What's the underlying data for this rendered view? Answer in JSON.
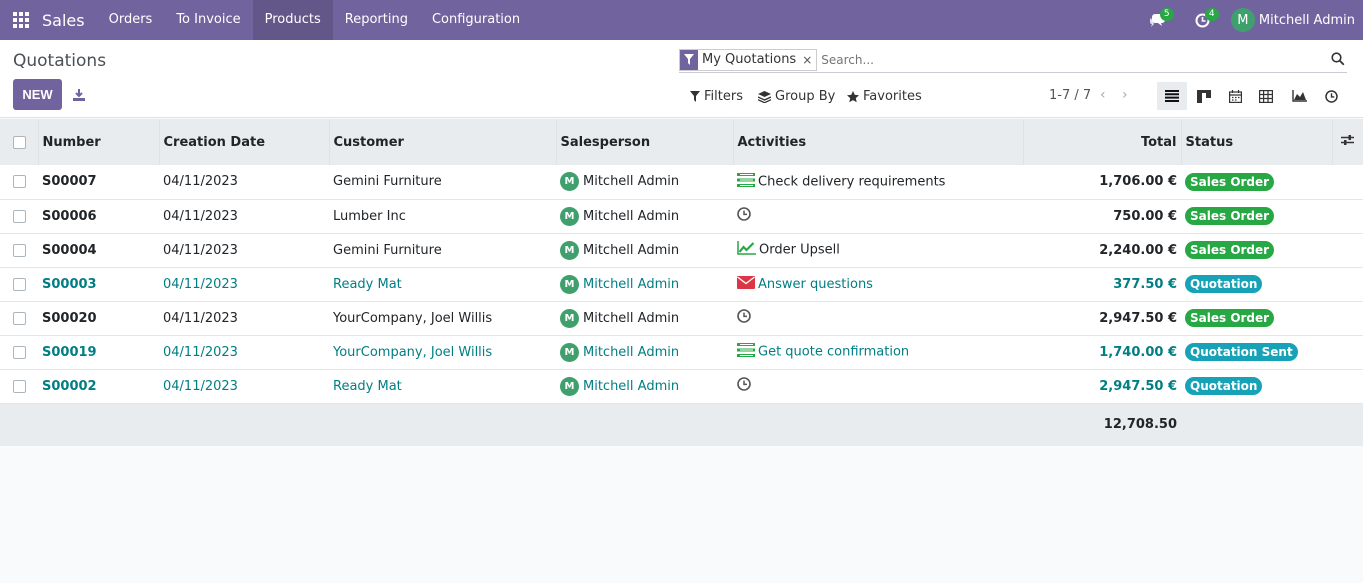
{
  "app": {
    "name": "Sales"
  },
  "nav": [
    "Orders",
    "To Invoice",
    "Products",
    "Reporting",
    "Configuration"
  ],
  "systray": {
    "messages_count": "5",
    "activities_count": "4",
    "user": "Mitchell Admin",
    "user_initial": "M"
  },
  "control": {
    "title": "Quotations",
    "new_label": "NEW",
    "facet": "My Quotations",
    "facet_remove": "×",
    "search_placeholder": "Search...",
    "filters": "Filters",
    "group_by": "Group By",
    "favorites": "Favorites",
    "pager": "1-7 / 7"
  },
  "columns": {
    "number": "Number",
    "creation_date": "Creation Date",
    "customer": "Customer",
    "salesperson": "Salesperson",
    "activities": "Activities",
    "total": "Total",
    "status": "Status"
  },
  "rows": [
    {
      "number": "S00007",
      "date": "04/11/2023",
      "customer": "Gemini Furniture",
      "salesperson": "Mitchell Admin",
      "activity": "Check delivery requirements",
      "activity_icon": "todo-list-icon",
      "total": "1,706.00 €",
      "status": "Sales Order"
    },
    {
      "number": "S00006",
      "date": "04/11/2023",
      "customer": "Lumber Inc",
      "salesperson": "Mitchell Admin",
      "activity": "",
      "activity_icon": "clock-icon",
      "total": "750.00 €",
      "status": "Sales Order"
    },
    {
      "number": "S00004",
      "date": "04/11/2023",
      "customer": "Gemini Furniture",
      "salesperson": "Mitchell Admin",
      "activity": "Order Upsell",
      "activity_icon": "chart-line-icon",
      "total": "2,240.00 €",
      "status": "Sales Order"
    },
    {
      "number": "S00003",
      "date": "04/11/2023",
      "customer": "Ready Mat",
      "salesperson": "Mitchell Admin",
      "activity": "Answer questions",
      "activity_icon": "envelope-icon",
      "total": "377.50 €",
      "status": "Quotation"
    },
    {
      "number": "S00020",
      "date": "04/11/2023",
      "customer": "YourCompany, Joel Willis",
      "salesperson": "Mitchell Admin",
      "activity": "",
      "activity_icon": "clock-icon",
      "total": "2,947.50 €",
      "status": "Sales Order"
    },
    {
      "number": "S00019",
      "date": "04/11/2023",
      "customer": "YourCompany, Joel Willis",
      "salesperson": "Mitchell Admin",
      "activity": "Get quote confirmation",
      "activity_icon": "todo-list-icon",
      "total": "1,740.00 €",
      "status": "Quotation Sent"
    },
    {
      "number": "S00002",
      "date": "04/11/2023",
      "customer": "Ready Mat",
      "salesperson": "Mitchell Admin",
      "activity": "",
      "activity_icon": "clock-icon",
      "total": "2,947.50 €",
      "status": "Quotation"
    }
  ],
  "grand_total": "12,708.50",
  "colors": {
    "brand": "#71639e",
    "link": "#017e84",
    "status_green": "#28a745",
    "status_blue": "#17a2b8"
  }
}
